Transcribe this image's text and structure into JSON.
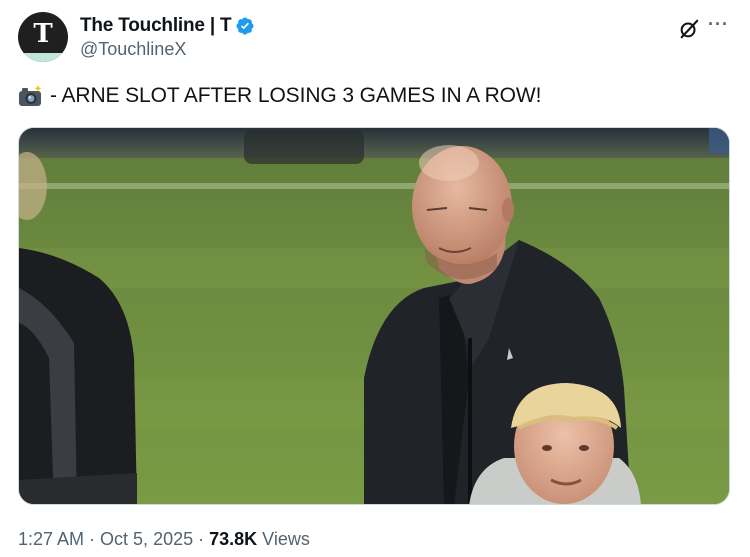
{
  "author": {
    "display_name": "The Touchline | T",
    "handle": "@TouchlineX",
    "avatar_letter": "T",
    "verified": true,
    "avatar_icon": "touchline-logo",
    "verified_icon": "verified-badge-icon"
  },
  "tweet": {
    "emoji_icon": "camera-flash-icon",
    "text": "- ARNE SLOT AFTER LOSING 3 GAMES IN A ROW!"
  },
  "actions": {
    "grok_icon": "grok-icon",
    "more_label": "···"
  },
  "meta": {
    "time": "1:27 AM",
    "separator": "·",
    "date": "Oct 5, 2025",
    "views_count": "73.8K",
    "views_label": "Views"
  },
  "colors": {
    "text_primary": "#0f1419",
    "text_secondary": "#536471",
    "verified_blue": "#1d9bf0",
    "border": "#cfd9de"
  }
}
